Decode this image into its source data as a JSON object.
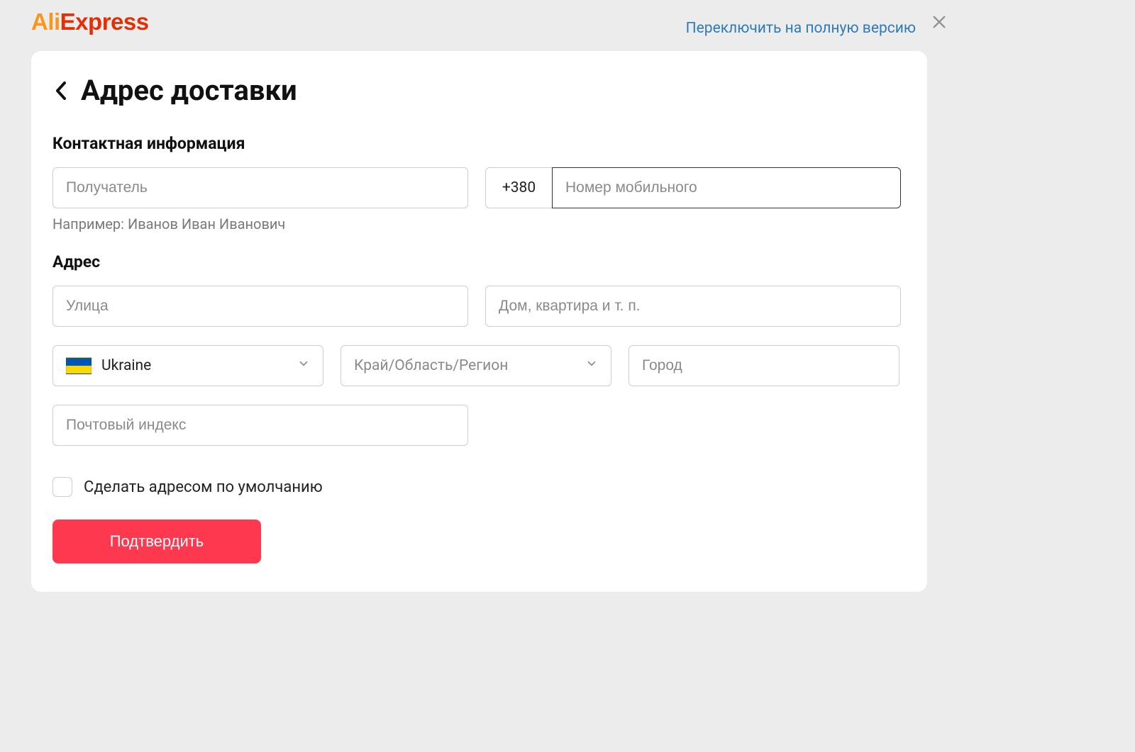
{
  "logo": {
    "text_part1": "Ali",
    "text_part2": "Express"
  },
  "topbar": {
    "switch_full_version": "Переключить на полную версию"
  },
  "page": {
    "title": "Адрес доставки"
  },
  "contact": {
    "heading": "Контактная информация",
    "recipient_placeholder": "Получатель",
    "recipient_hint": "Например: Иванов Иван Иванович",
    "phone_prefix": "+380",
    "phone_placeholder": "Номер мобильного"
  },
  "address": {
    "heading": "Адрес",
    "street_placeholder": "Улица",
    "apt_placeholder": "Дом, квартира и т. п.",
    "country_value": "Ukraine",
    "region_placeholder": "Край/Область/Регион",
    "city_placeholder": "Город",
    "postal_placeholder": "Почтовый индекс"
  },
  "default_checkbox": {
    "label": "Сделать адресом по умолчанию"
  },
  "submit": {
    "label": "Подтвердить"
  }
}
